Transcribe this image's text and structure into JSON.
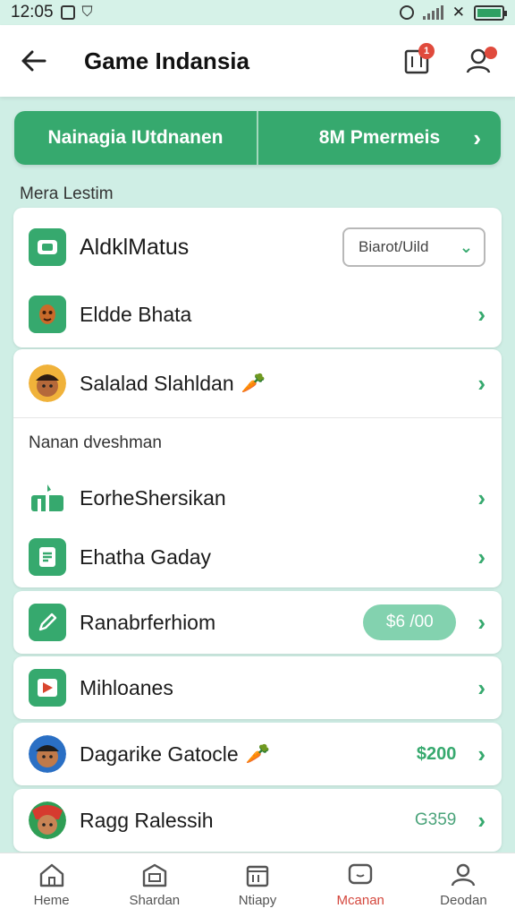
{
  "status": {
    "time": "12:05"
  },
  "appbar": {
    "title": "Game Indansia",
    "notification_count": "1"
  },
  "banner": {
    "left": "Nainagia IUtdnanen",
    "right": "8M Pmermeis"
  },
  "section1_label": "Mera Lestim",
  "card1": {
    "row1": {
      "label": "AldklMatus",
      "select_value": "Biarot/Uild"
    },
    "row2": {
      "label": "Eldde Bhata"
    }
  },
  "card2": {
    "row1": {
      "label": "Salalad Slahldan"
    },
    "sub_label": "Nanan dveshman",
    "row2": {
      "label": "EorheShersikan"
    },
    "row3": {
      "label": "Ehatha Gaday"
    }
  },
  "card3": {
    "label": "Ranabrferhiom",
    "pill": "$6 /00"
  },
  "card4": {
    "label": "Mihloanes"
  },
  "card5": {
    "label": "Dagarike Gatocle",
    "amount": "$200"
  },
  "card6": {
    "label": "Ragg Ralessih",
    "amount": "G359"
  },
  "nav": [
    {
      "label": "Heme"
    },
    {
      "label": "Shardan"
    },
    {
      "label": "Ntiapy"
    },
    {
      "label": "Mcanan"
    },
    {
      "label": "Deodan"
    }
  ],
  "colors": {
    "accent": "#36a96e",
    "active_nav": "#d4473d",
    "badge": "#e04a3c",
    "background": "#cfeee5"
  }
}
